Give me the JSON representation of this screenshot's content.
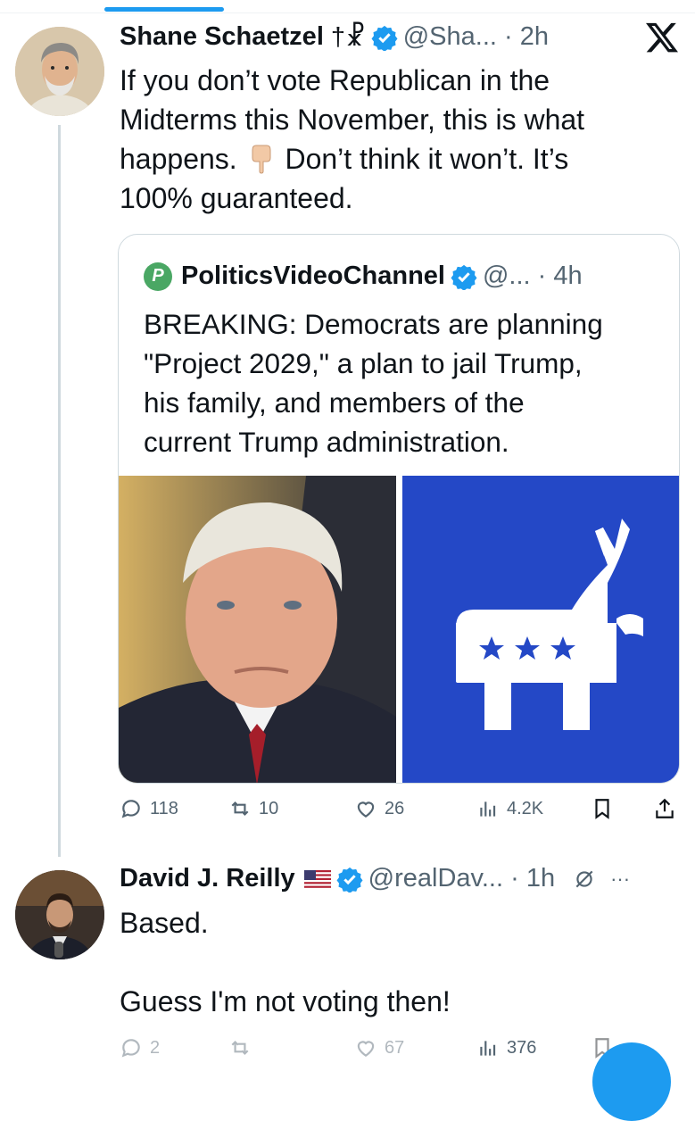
{
  "thread": {
    "tweet1": {
      "author_name": "Shane Schaetzel",
      "author_symbols": "†☧",
      "handle": "@Sha...",
      "time": "2h",
      "text_lines": [
        "If you don’t vote Republican in the",
        "Midterms this November, this is what",
        "happens.",
        "Don’t think it won’t. It’s",
        "100% guaranteed."
      ],
      "emoji": "pointing-down-hand",
      "quote": {
        "author_name": "PoliticsVideoChannel",
        "logo_letter": "P",
        "handle": "@...",
        "time": "4h",
        "text_lines": [
          "BREAKING: Democrats are planning",
          "\"Project 2029,\" a plan to jail Trump,",
          "his family, and members of the",
          "current Trump administration."
        ],
        "images": [
          "photo-of-donald-trump",
          "democratic-party-donkey-logo"
        ]
      },
      "actions": {
        "replies": "118",
        "reposts": "10",
        "likes": "26",
        "views": "4.2K"
      }
    },
    "tweet2": {
      "author_name": "David J. Reilly",
      "flag": "us-flag",
      "handle": "@realDav...",
      "time": "1h",
      "text_lines": [
        "Based.",
        "",
        "Guess I'm not voting then!"
      ],
      "actions": {
        "replies": "2",
        "reposts": "",
        "likes": "67",
        "views": "376"
      }
    }
  },
  "colors": {
    "accent": "#1d9bf0",
    "muted": "#536471",
    "border": "#cfd9de",
    "dem_blue": "#2448c6"
  }
}
